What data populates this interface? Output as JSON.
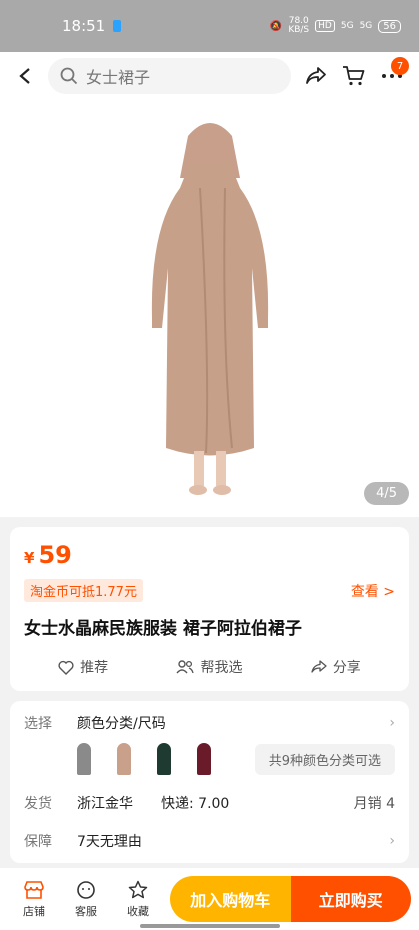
{
  "status": {
    "time": "18:51",
    "speed_value": "78.0",
    "speed_unit": "KB/S",
    "hd": "HD",
    "signal1": "5G",
    "signal2": "5G",
    "battery": "56"
  },
  "nav": {
    "search_placeholder": "女士裙子",
    "cart_badge": "7"
  },
  "gallery": {
    "pager": "4/5",
    "product_color": "#c7a08a"
  },
  "product": {
    "currency": "¥",
    "price": "59",
    "coin_label": "淘金币可抵1.77元",
    "view_label": "查看 >",
    "title": "女士水晶麻民族服装 裙子阿拉伯裙子",
    "actions": [
      {
        "label": "推荐"
      },
      {
        "label": "帮我选"
      },
      {
        "label": "分享"
      }
    ]
  },
  "spec": {
    "select_label": "选择",
    "select_value": "颜色分类/尺码",
    "thumb_colors": [
      "#8a8a8a",
      "#c9a08a",
      "#1f3a30",
      "#6a1b2a"
    ],
    "more_colors": "共9种颜色分类可选",
    "ship_label": "发货",
    "ship_from": "浙江金华",
    "express": "快递: 7.00",
    "monthly_sales": "月销  4",
    "guarantee_label": "保障",
    "guarantee_value": "7天无理由"
  },
  "bottom": {
    "tabs": [
      {
        "label": "店铺"
      },
      {
        "label": "客服"
      },
      {
        "label": "收藏"
      }
    ],
    "add_cart": "加入购物车",
    "buy_now": "立即购买"
  },
  "colors": {
    "accent": "#ff5000",
    "secondary": "#ffb400"
  }
}
